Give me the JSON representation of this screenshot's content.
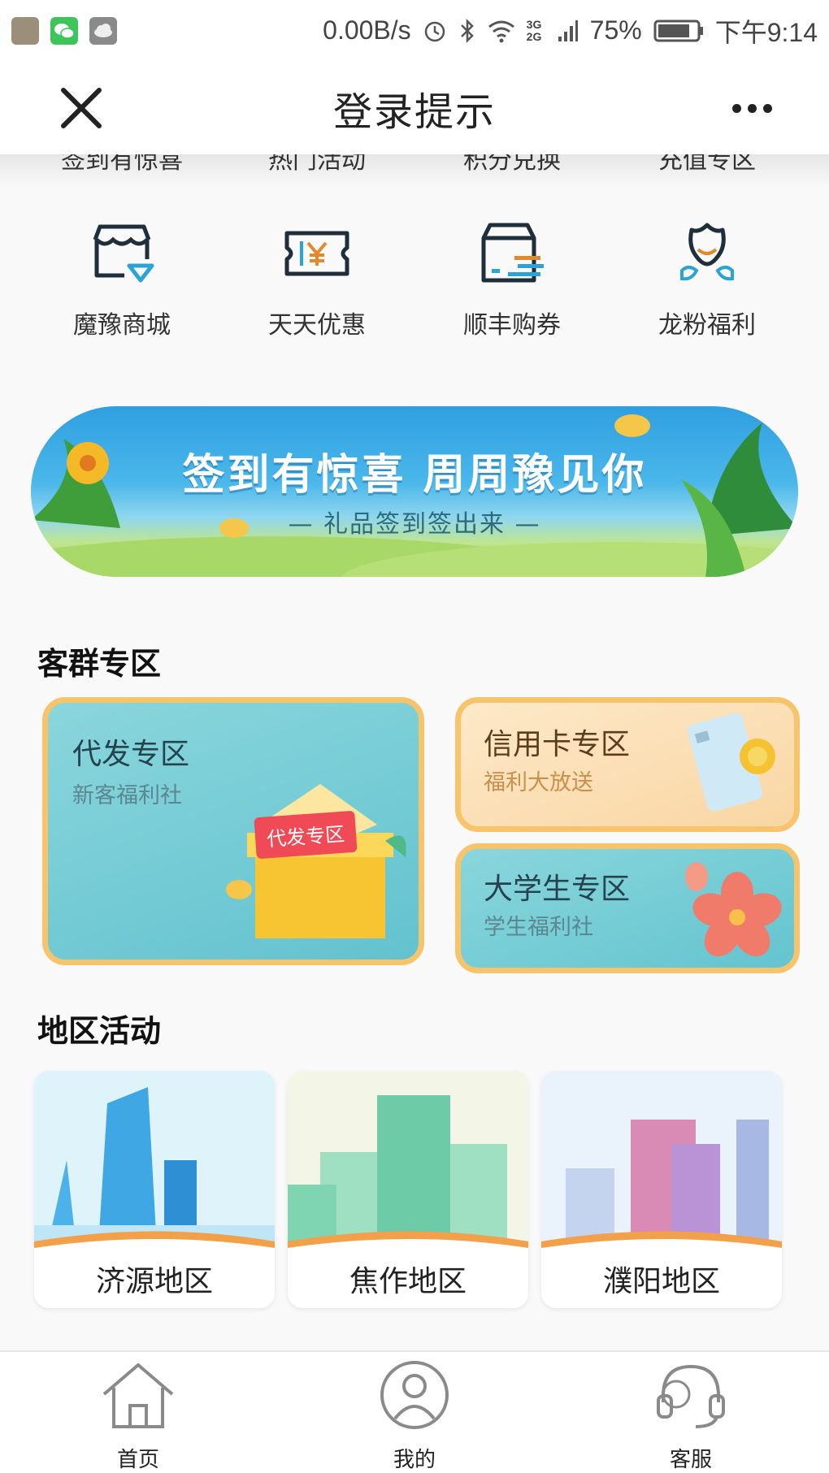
{
  "status_bar": {
    "speed": "0.00B/s",
    "network": "3G 2G",
    "battery": "75%",
    "time": "下午9:14"
  },
  "navbar": {
    "title": "登录提示"
  },
  "top_row": [
    "签到有惊喜",
    "热门活动",
    "积分兑换",
    "充值专区"
  ],
  "services": [
    {
      "label": "魔豫商城",
      "icon": "store-icon"
    },
    {
      "label": "天天优惠",
      "icon": "coupon-icon"
    },
    {
      "label": "顺丰购券",
      "icon": "parcel-icon"
    },
    {
      "label": "龙粉福利",
      "icon": "lotus-icon"
    }
  ],
  "banner": {
    "title": "签到有惊喜 周周豫见你",
    "subtitle": "— 礼品签到签出来 —"
  },
  "customer_section": {
    "title": "客群专区",
    "cards": {
      "daifa": {
        "title": "代发专区",
        "subtitle": "新客福利社",
        "box_label": "代发专区"
      },
      "credit": {
        "title": "信用卡专区",
        "subtitle": "福利大放送"
      },
      "student": {
        "title": "大学生专区",
        "subtitle": "学生福利社"
      }
    }
  },
  "region_section": {
    "title": "地区活动",
    "regions": [
      "济源地区",
      "焦作地区",
      "濮阳地区"
    ]
  },
  "tabbar": [
    "首页",
    "我的",
    "客服"
  ],
  "colors": {
    "accent_teal": "#63c2cf",
    "frame_orange": "#f7c36b",
    "banner_blue": "#2f9fe0"
  }
}
